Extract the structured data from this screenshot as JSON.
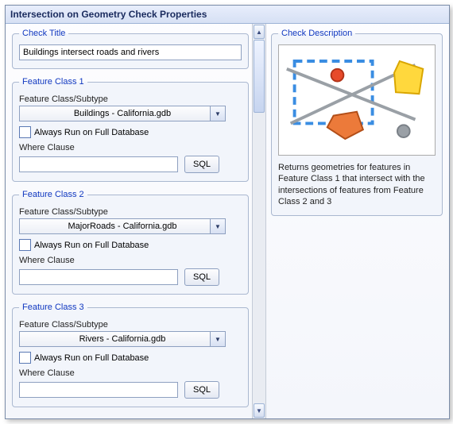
{
  "window": {
    "title": "Intersection on Geometry Check Properties"
  },
  "checkTitle": {
    "legend": "Check Title",
    "value": "Buildings intersect roads and rivers"
  },
  "featureClasses": [
    {
      "legend": "Feature Class 1",
      "subtypeLabel": "Feature Class/Subtype",
      "combo": "Buildings -  California.gdb",
      "alwaysRun": "Always Run on Full Database",
      "whereLabel": "Where Clause",
      "whereValue": "",
      "sql": "SQL"
    },
    {
      "legend": "Feature Class 2",
      "subtypeLabel": "Feature Class/Subtype",
      "combo": "MajorRoads -  California.gdb",
      "alwaysRun": "Always Run on Full Database",
      "whereLabel": "Where Clause",
      "whereValue": "",
      "sql": "SQL"
    },
    {
      "legend": "Feature Class 3",
      "subtypeLabel": "Feature Class/Subtype",
      "combo": "Rivers -  California.gdb",
      "alwaysRun": "Always Run on Full Database",
      "whereLabel": "Where Clause",
      "whereValue": "",
      "sql": "SQL"
    }
  ],
  "description": {
    "legend": "Check Description",
    "text": "Returns geometries for features in Feature Class 1 that intersect with the intersections of features from Feature Class 2 and 3"
  }
}
